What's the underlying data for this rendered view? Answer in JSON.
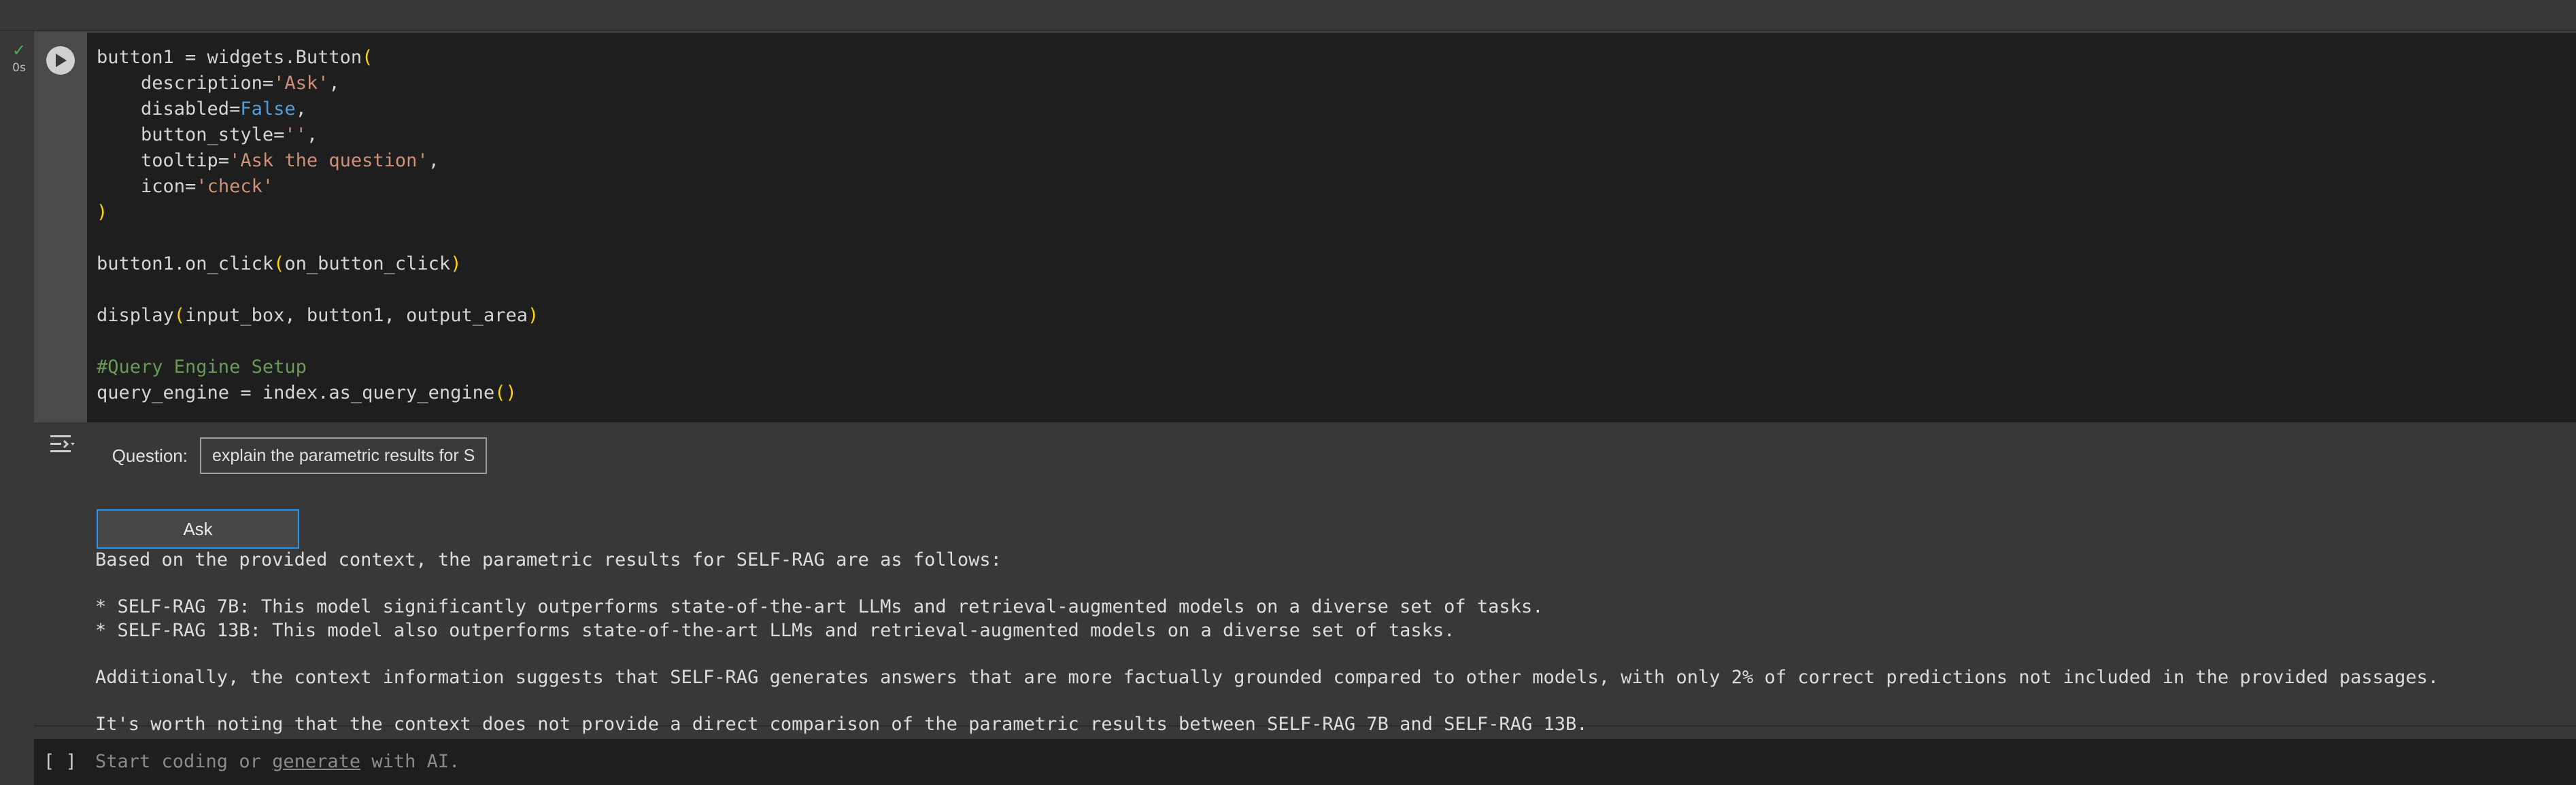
{
  "top_cut_text": "",
  "run_status": {
    "check": "✓",
    "time": "0s"
  },
  "code_lines": [
    [
      {
        "t": "button1 = widgets.Button",
        "c": ""
      },
      {
        "t": "(",
        "c": "paren"
      }
    ],
    [
      {
        "t": "    description=",
        "c": ""
      },
      {
        "t": "'Ask'",
        "c": "str"
      },
      {
        "t": ",",
        "c": ""
      }
    ],
    [
      {
        "t": "    disabled=",
        "c": ""
      },
      {
        "t": "False",
        "c": "kw"
      },
      {
        "t": ",",
        "c": ""
      }
    ],
    [
      {
        "t": "    button_style=",
        "c": ""
      },
      {
        "t": "''",
        "c": "str"
      },
      {
        "t": ",",
        "c": ""
      }
    ],
    [
      {
        "t": "    tooltip=",
        "c": ""
      },
      {
        "t": "'Ask the question'",
        "c": "str"
      },
      {
        "t": ",",
        "c": ""
      }
    ],
    [
      {
        "t": "    icon=",
        "c": ""
      },
      {
        "t": "'check'",
        "c": "str"
      }
    ],
    [
      {
        "t": ")",
        "c": "paren"
      }
    ],
    [
      {
        "t": "",
        "c": ""
      }
    ],
    [
      {
        "t": "button1.on_click",
        "c": ""
      },
      {
        "t": "(",
        "c": "paren"
      },
      {
        "t": "on_button_click",
        "c": ""
      },
      {
        "t": ")",
        "c": "paren"
      }
    ],
    [
      {
        "t": "",
        "c": ""
      }
    ],
    [
      {
        "t": "display",
        "c": ""
      },
      {
        "t": "(",
        "c": "paren"
      },
      {
        "t": "input_box, button1, output_area",
        "c": ""
      },
      {
        "t": ")",
        "c": "paren"
      }
    ],
    [
      {
        "t": "",
        "c": ""
      }
    ],
    [
      {
        "t": "#Query Engine Setup",
        "c": "comment"
      }
    ],
    [
      {
        "t": "query_engine = index.as_query_engine",
        "c": ""
      },
      {
        "t": "()",
        "c": "paren"
      }
    ]
  ],
  "widget": {
    "label": "Question:",
    "input_value": "explain the parametric results for SELF-RAG",
    "button_label": "Ask"
  },
  "output_lines": [
    "Based on the provided context, the parametric results for SELF-RAG are as follows:",
    "",
    "* SELF-RAG 7B: This model significantly outperforms state-of-the-art LLMs and retrieval-augmented models on a diverse set of tasks.",
    "* SELF-RAG 13B: This model also outperforms state-of-the-art LLMs and retrieval-augmented models on a diverse set of tasks.",
    "",
    "Additionally, the context information suggests that SELF-RAG generates answers that are more factually grounded compared to other models, with only 2% of correct predictions not included in the provided passages.",
    "",
    "It's worth noting that the context does not provide a direct comparison of the parametric results between SELF-RAG 7B and SELF-RAG 13B."
  ],
  "new_cell": {
    "brackets": "[ ]",
    "prefix": "Start coding or ",
    "link": "generate",
    "suffix": " with AI."
  },
  "colors": {
    "string": "#ce9178",
    "keyword": "#569cd6",
    "paren": "#ffd700",
    "comment": "#6a9955",
    "focus_border": "#2196f3",
    "success": "#4caf50"
  }
}
